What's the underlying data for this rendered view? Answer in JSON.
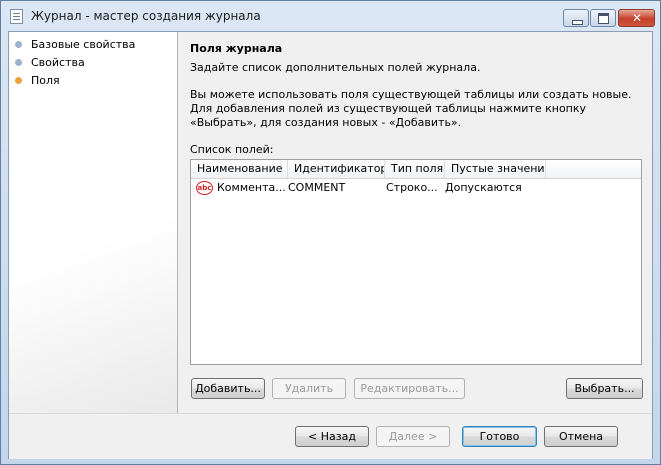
{
  "window": {
    "title": "Журнал - мастер создания журнала"
  },
  "sidebar": {
    "items": [
      {
        "label": "Базовые свойства",
        "color": "#9fb2cc"
      },
      {
        "label": "Свойства",
        "color": "#9fb2cc"
      },
      {
        "label": "Поля",
        "color": "#f0a13c"
      }
    ]
  },
  "section": {
    "title": "Поля журнала",
    "subtitle": "Задайте список дополнительных полей журнала.",
    "description": "Вы можете использовать поля существующей таблицы или создать новые. Для добавления полей из существующей таблицы нажмите кнопку «Выбрать», для создания новых - «Добавить».",
    "list_label": "Список полей:"
  },
  "grid": {
    "columns": [
      "Наименование",
      "Идентификатор",
      "Тип поля",
      "Пустые значения"
    ],
    "rows": [
      {
        "icon": "abc-text-icon",
        "name": "Коммента...",
        "id": "COMMENT",
        "type": "Строко...",
        "nulls": "Допускаются"
      }
    ]
  },
  "grid_buttons": {
    "add": "Добавить...",
    "delete": "Удалить",
    "edit": "Редактировать...",
    "select": "Выбрать..."
  },
  "footer_buttons": {
    "back": "< Назад",
    "next": "Далее >",
    "finish": "Готово",
    "cancel": "Отмена"
  }
}
